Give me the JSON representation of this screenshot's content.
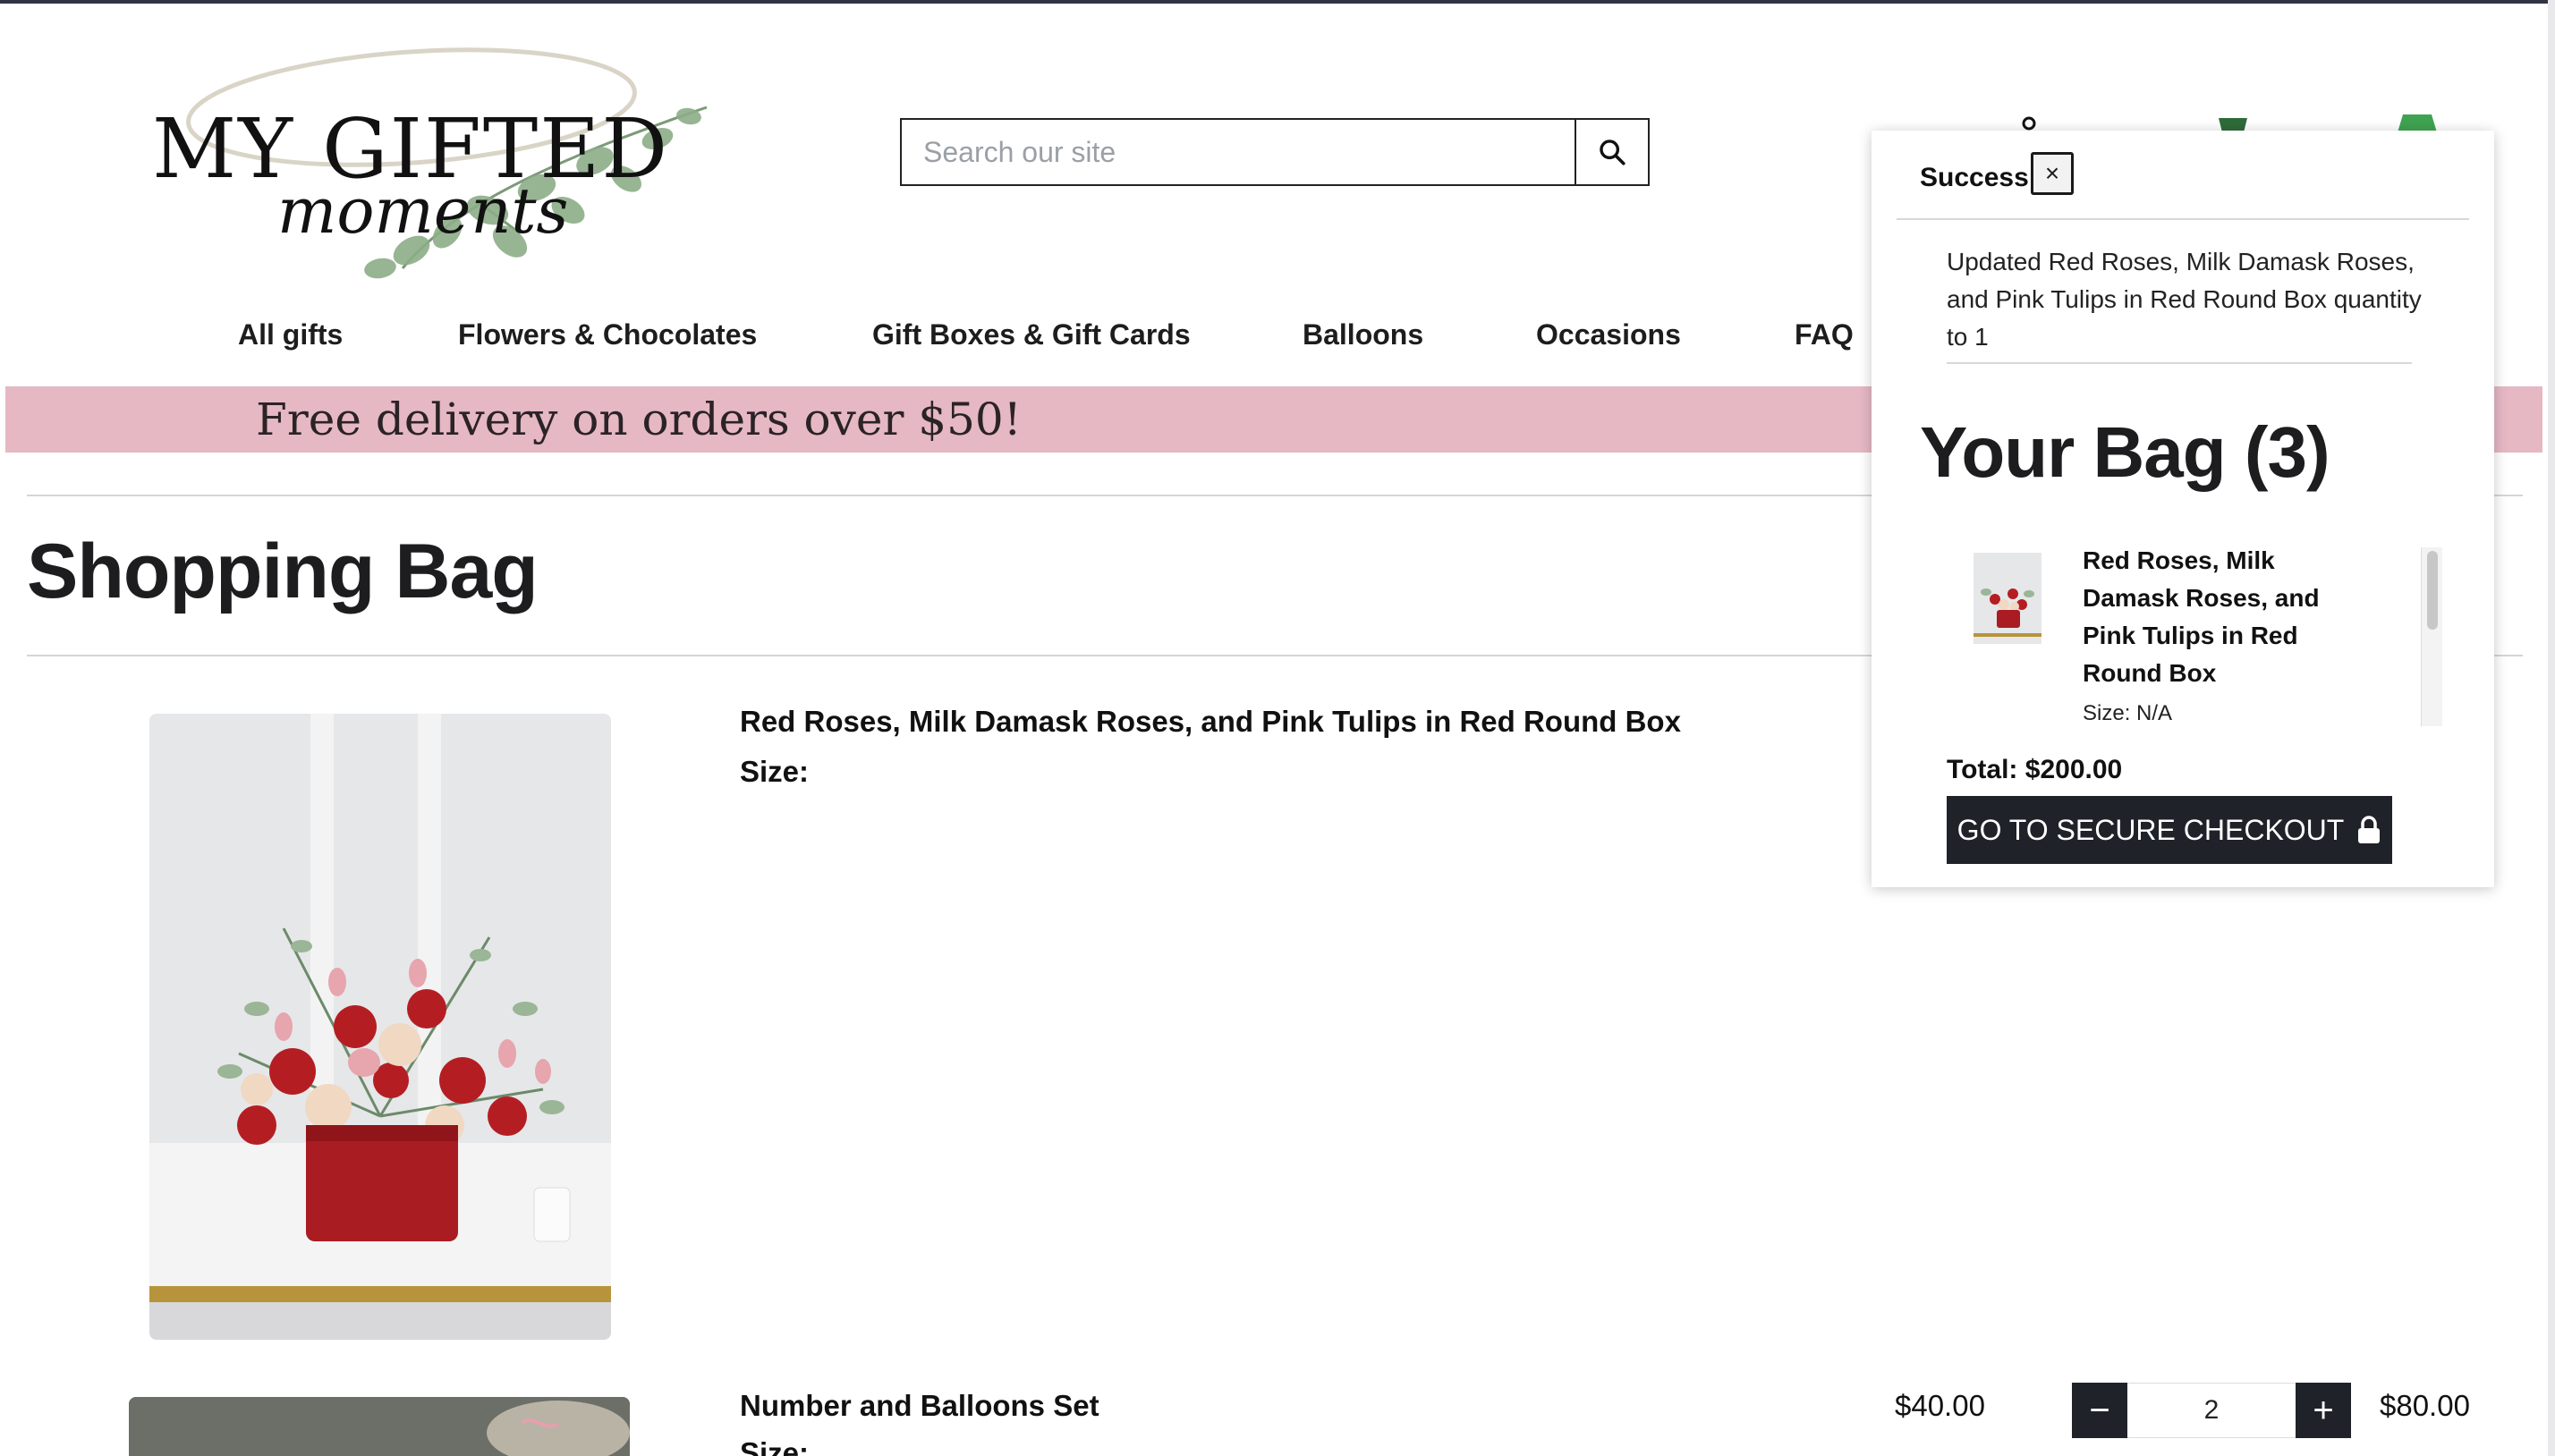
{
  "header": {
    "logo_text_top": "MY GIFTED",
    "logo_text_bottom": "moments",
    "search_placeholder": "Search our site"
  },
  "nav": {
    "items": [
      "All gifts",
      "Flowers & Chocolates",
      "Gift Boxes & Gift Cards",
      "Balloons",
      "Occasions",
      "FAQ"
    ]
  },
  "banner": {
    "text": "Free delivery on orders over $50!"
  },
  "page": {
    "title": "Shopping Bag"
  },
  "cart_items": [
    {
      "name": "Red Roses, Milk Damask Roses, and Pink Tulips in Red Round Box",
      "size_label": "Size:"
    },
    {
      "name": "Number and Balloons Set",
      "size_label": "Size:",
      "unit_price": "$40.00",
      "quantity": "2",
      "line_total": "$80.00"
    }
  ],
  "qty_controls": {
    "minus": "−",
    "plus": "+"
  },
  "mini_cart": {
    "success_label": "Success!",
    "close_label": "×",
    "message": "Updated Red Roses, Milk Damask Roses, and Pink Tulips in Red Round Box quantity to 1",
    "title": "Your Bag (3)",
    "item_name": "Red Roses, Milk Damask Roses, and Pink Tulips in Red Round Box",
    "item_size": "Size: N/A",
    "total": "Total: $200.00",
    "checkout_label": "GO TO SECURE CHECKOUT"
  },
  "colors": {
    "banner_bg": "#e5b8c4",
    "dark_button": "#1f2329",
    "accent_green": "#2e7d3a"
  },
  "icons": [
    "search-icon",
    "lock-icon",
    "close-icon",
    "account-icon",
    "cart-icon"
  ]
}
